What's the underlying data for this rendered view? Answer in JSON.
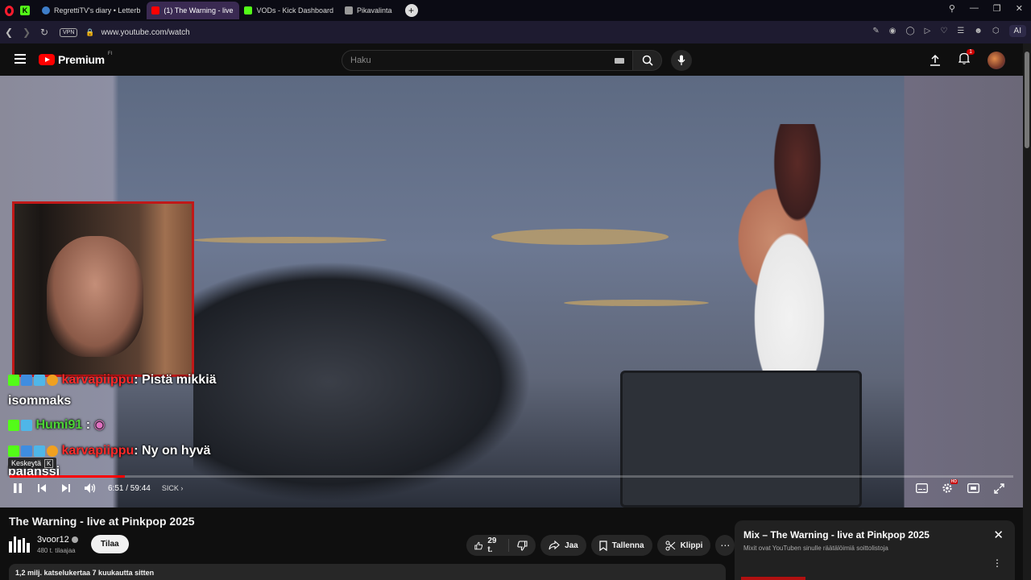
{
  "browser": {
    "tabs": [
      {
        "label": "RegrettiTV's diary • Letterb",
        "color": "#3e7ec9"
      },
      {
        "label": "(1) The Warning - live",
        "color": "#ff0000",
        "active": true
      },
      {
        "label": "VODs - Kick Dashboard",
        "color": "#53fc18"
      },
      {
        "label": "Pikavalinta",
        "color": "#999999"
      }
    ],
    "url": "www.youtube.com/watch",
    "vpn_label": "VPN",
    "ai_label": "AI"
  },
  "header": {
    "logo_text": "Premium",
    "region": "FI",
    "search_placeholder": "Haku",
    "notification_count": "1"
  },
  "player": {
    "chat": [
      {
        "user": "karvapiippu",
        "user_color": "red",
        "message": ": Pistä mikkiä isommaks"
      },
      {
        "user": "Humi91",
        "user_color": "green",
        "message": " :"
      },
      {
        "user": "karvapiippu",
        "user_color": "red",
        "message": ": Ny on hyvä balanssi"
      }
    ],
    "tooltip": "Keskeytä",
    "tooltip_key": "K",
    "time": "6:51 / 59:44",
    "chapter": "SICK",
    "progress": 0.115,
    "hd_badge": "HD"
  },
  "video": {
    "title": "The Warning - live at Pinkpop 2025",
    "channel_name": "3voor12",
    "subscribers": "480 t. tilaajaa",
    "subscribe_label": "Tilaa",
    "likes": "29 t.",
    "share_label": "Jaa",
    "save_label": "Tallenna",
    "clip_label": "Klippi",
    "views_line": "1,2 milj. katselukertaa  7 kuukautta sitten"
  },
  "mix": {
    "title": "Mix – The Warning - live at Pinkpop 2025",
    "subtitle": "Mixit ovat YouTuben sinulle räätälöimiä soittolistoja"
  }
}
